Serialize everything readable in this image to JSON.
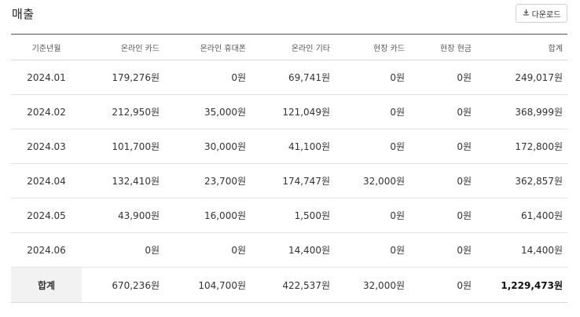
{
  "page": {
    "title": "매출"
  },
  "toolbar": {
    "download_label": "다운로드"
  },
  "table": {
    "columns": [
      "기준년월",
      "온라인 카드",
      "온라인 휴대폰",
      "온라인 기타",
      "현장 카드",
      "현장 현금",
      "합계"
    ],
    "rows": [
      [
        "2024.01",
        "179,276원",
        "0원",
        "69,741원",
        "0원",
        "0원",
        "249,017원"
      ],
      [
        "2024.02",
        "212,950원",
        "35,000원",
        "121,049원",
        "0원",
        "0원",
        "368,999원"
      ],
      [
        "2024.03",
        "101,700원",
        "30,000원",
        "41,100원",
        "0원",
        "0원",
        "172,800원"
      ],
      [
        "2024.04",
        "132,410원",
        "23,700원",
        "174,747원",
        "32,000원",
        "0원",
        "362,857원"
      ],
      [
        "2024.05",
        "43,900원",
        "16,000원",
        "1,500원",
        "0원",
        "0원",
        "61,400원"
      ],
      [
        "2024.06",
        "0원",
        "0원",
        "14,400원",
        "0원",
        "0원",
        "14,400원"
      ]
    ],
    "total": [
      "합계",
      "670,236원",
      "104,700원",
      "422,537원",
      "32,000원",
      "0원",
      "1,229,473원"
    ]
  }
}
